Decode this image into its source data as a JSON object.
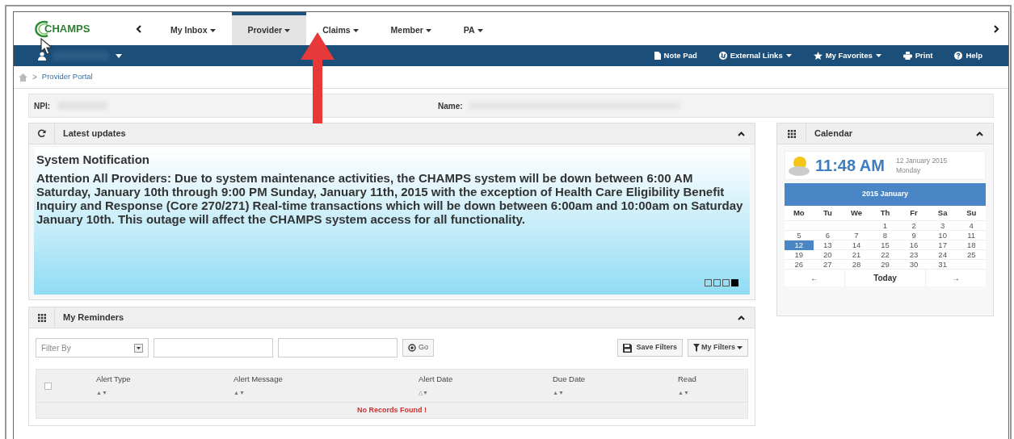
{
  "logo": {
    "text": "CHAMPS"
  },
  "nav_tabs": [
    {
      "label": "My Inbox",
      "selected": false
    },
    {
      "label": "Provider",
      "selected": true
    },
    {
      "label": "Claims",
      "selected": false
    },
    {
      "label": "Member",
      "selected": false
    },
    {
      "label": "PA",
      "selected": false
    }
  ],
  "toolbar": [
    {
      "kind": "notepad",
      "label": "Note Pad",
      "dropdown": false
    },
    {
      "kind": "globe",
      "label": "External Links",
      "dropdown": true
    },
    {
      "kind": "star",
      "label": "My Favorites",
      "dropdown": true
    },
    {
      "kind": "print",
      "label": "Print",
      "dropdown": false
    },
    {
      "kind": "help",
      "label": "Help",
      "dropdown": false
    }
  ],
  "breadcrumb": {
    "separator": ">",
    "items": [
      "Provider Portal"
    ]
  },
  "info_bar": [
    {
      "label": "NPI:"
    },
    {
      "label": "Name:"
    }
  ],
  "latest_updates": {
    "title": "Latest updates",
    "heading": "System Notification",
    "message": "Attention All Providers: Due to system maintenance activities, the CHAMPS system will be down between 6:00 AM Saturday, January 10th through 9:00 PM Sunday, January 11th, 2015 with the exception of Health Care Eligibility Benefit Inquiry and Response (Core 270/271) Real-time transactions which will be down between 6:00am and 10:00am on Saturday January 10th. This outage will affect the CHAMPS system access for all functionality.",
    "slides": [
      {
        "selected": false
      },
      {
        "selected": false
      },
      {
        "selected": false
      },
      {
        "selected": true
      }
    ]
  },
  "reminders": {
    "title": "My Reminders",
    "filter_placeholder": "Filter By",
    "go": "Go",
    "save_filters": "Save Filters",
    "my_filters": "My Filters",
    "select_all_checked": false,
    "columns": [
      {
        "label": "Alert Type",
        "sort": "▲▼"
      },
      {
        "label": "Alert Message",
        "sort": "▲▼"
      },
      {
        "label": "Alert Date",
        "sort": "△▼"
      },
      {
        "label": "Due Date",
        "sort": "▲▼"
      },
      {
        "label": "Read",
        "sort": "▲▼"
      }
    ],
    "empty_message": "No Records Found !"
  },
  "calendar": {
    "title": "Calendar",
    "time": "11:48 AM",
    "date": "12 January 2015",
    "weekday": "Monday",
    "month": "2015 January",
    "weekdays": [
      "Mo",
      "Tu",
      "We",
      "Th",
      "Fr",
      "Sa",
      "Su"
    ],
    "weeks": [
      [
        {
          "kind": "blank"
        },
        {
          "kind": "blank"
        },
        {
          "kind": "blank"
        },
        {
          "kind": "day",
          "day": "1",
          "selected": false
        },
        {
          "kind": "day",
          "day": "2",
          "selected": false
        },
        {
          "kind": "day",
          "day": "3",
          "selected": false
        },
        {
          "kind": "day",
          "day": "4",
          "selected": false
        }
      ],
      [
        {
          "kind": "day",
          "day": "5",
          "selected": false
        },
        {
          "kind": "day",
          "day": "6",
          "selected": false
        },
        {
          "kind": "day",
          "day": "7",
          "selected": false
        },
        {
          "kind": "day",
          "day": "8",
          "selected": false
        },
        {
          "kind": "day",
          "day": "9",
          "selected": false
        },
        {
          "kind": "day",
          "day": "10",
          "selected": false
        },
        {
          "kind": "day",
          "day": "11",
          "selected": false
        }
      ],
      [
        {
          "kind": "day",
          "day": "12",
          "selected": true
        },
        {
          "kind": "day",
          "day": "13",
          "selected": false
        },
        {
          "kind": "day",
          "day": "14",
          "selected": false
        },
        {
          "kind": "day",
          "day": "15",
          "selected": false
        },
        {
          "kind": "day",
          "day": "16",
          "selected": false
        },
        {
          "kind": "day",
          "day": "17",
          "selected": false
        },
        {
          "kind": "day",
          "day": "18",
          "selected": false
        }
      ],
      [
        {
          "kind": "day",
          "day": "19",
          "selected": false
        },
        {
          "kind": "day",
          "day": "20",
          "selected": false
        },
        {
          "kind": "day",
          "day": "21",
          "selected": false
        },
        {
          "kind": "day",
          "day": "22",
          "selected": false
        },
        {
          "kind": "day",
          "day": "23",
          "selected": false
        },
        {
          "kind": "day",
          "day": "24",
          "selected": false
        },
        {
          "kind": "day",
          "day": "25",
          "selected": false
        }
      ],
      [
        {
          "kind": "day",
          "day": "26",
          "selected": false
        },
        {
          "kind": "day",
          "day": "27",
          "selected": false
        },
        {
          "kind": "day",
          "day": "28",
          "selected": false
        },
        {
          "kind": "day",
          "day": "29",
          "selected": false
        },
        {
          "kind": "day",
          "day": "30",
          "selected": false
        },
        {
          "kind": "day",
          "day": "31",
          "selected": false
        },
        {
          "kind": "blank"
        }
      ]
    ],
    "prev": "←",
    "today": "Today",
    "next": "→"
  }
}
